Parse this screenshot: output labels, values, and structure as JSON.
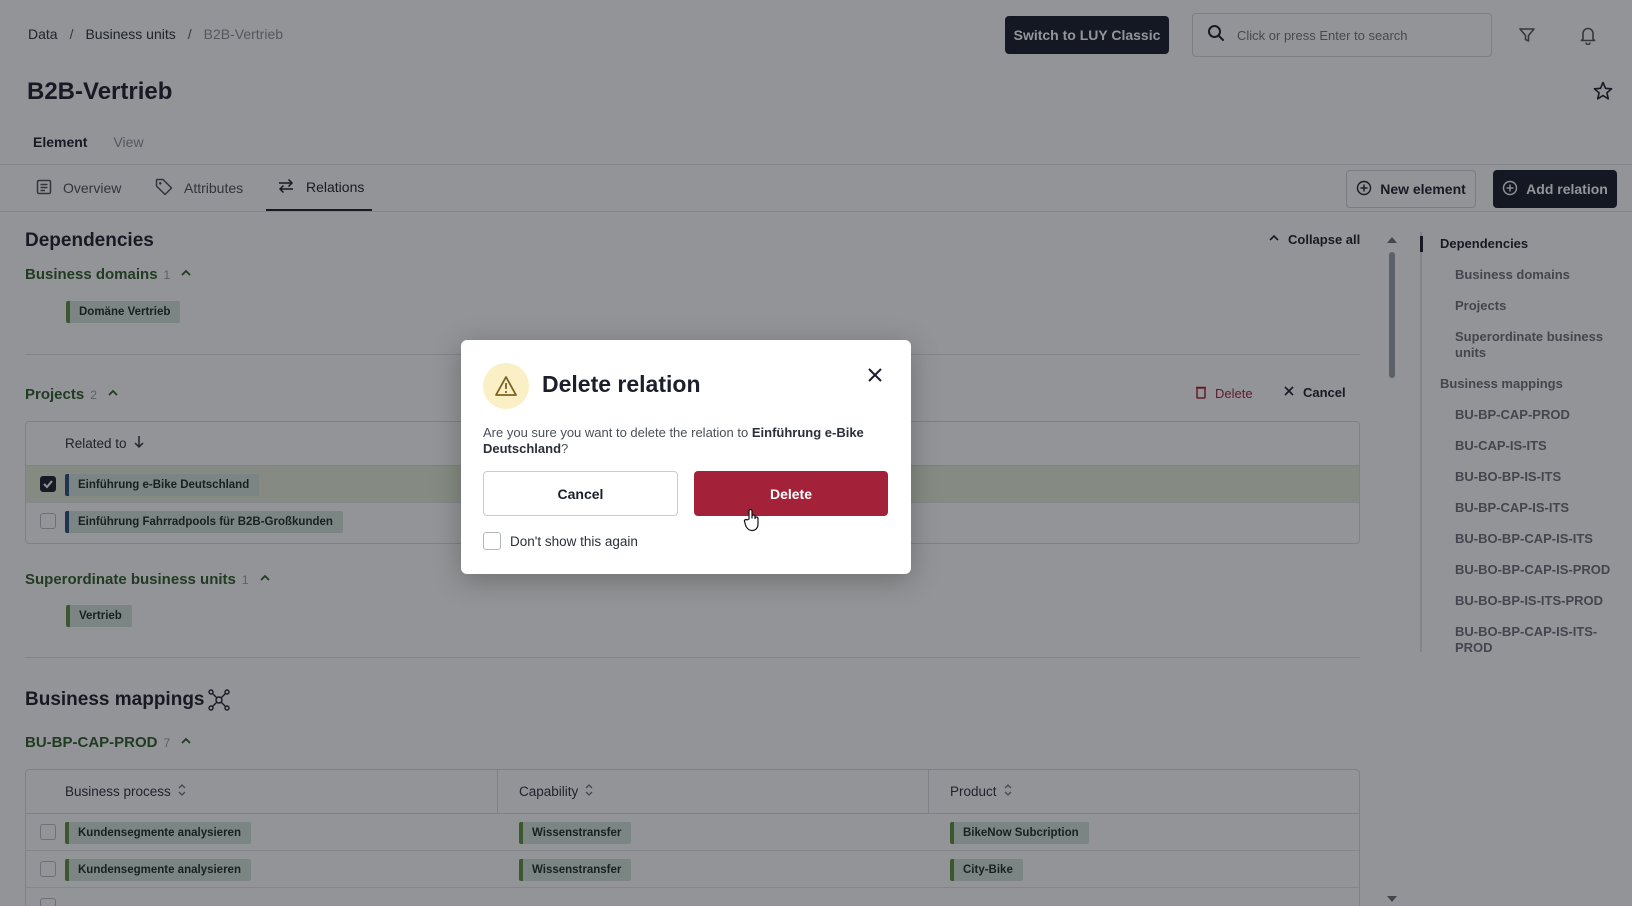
{
  "breadcrumb": {
    "root": "Data",
    "parent": "Business units",
    "current": "B2B-Vertrieb"
  },
  "header": {
    "switch_label": "Switch to LUY Classic",
    "search_placeholder": "Click or press Enter to search"
  },
  "page": {
    "title": "B2B-Vertrieb"
  },
  "subtabs": {
    "element": "Element",
    "view": "View"
  },
  "tabs": {
    "overview": "Overview",
    "attributes": "Attributes",
    "relations": "Relations"
  },
  "toolbar": {
    "new_element": "New element",
    "add_relation": "Add relation"
  },
  "dependencies": {
    "title": "Dependencies",
    "collapse_all": "Collapse all",
    "business_domains": {
      "label": "Business domains",
      "count": "1",
      "items": [
        "Domäne Vertrieb"
      ]
    },
    "projects": {
      "label": "Projects",
      "count": "2",
      "delete": "Delete",
      "cancel": "Cancel",
      "column": "Related to",
      "rows": [
        {
          "name": "Einführung e-Bike Deutschland",
          "checked": true
        },
        {
          "name": "Einführung Fahrradpools für B2B-Großkunden",
          "checked": false
        }
      ]
    },
    "superordinate": {
      "label": "Superordinate business units",
      "count": "1",
      "items": [
        "Vertrieb"
      ]
    }
  },
  "business_mappings": {
    "title": "Business mappings",
    "group": {
      "label": "BU-BP-CAP-PROD",
      "count": "7"
    },
    "columns": [
      "Business process",
      "Capability",
      "Product"
    ],
    "rows": [
      [
        "Kundensegmente analysieren",
        "Wissenstransfer",
        "BikeNow Subcription"
      ],
      [
        "Kundensegmente analysieren",
        "Wissenstransfer",
        "City-Bike"
      ]
    ]
  },
  "right_nav": {
    "dependencies": "Dependencies",
    "dep_items": [
      "Business domains",
      "Projects",
      "Superordinate business units"
    ],
    "mappings": "Business mappings",
    "map_items": [
      "BU-BP-CAP-PROD",
      "BU-CAP-IS-ITS",
      "BU-BO-BP-IS-ITS",
      "BU-BP-CAP-IS-ITS",
      "BU-BO-BP-CAP-IS-ITS",
      "BU-BO-BP-CAP-IS-PROD",
      "BU-BO-BP-IS-ITS-PROD",
      "BU-BO-BP-CAP-IS-ITS-PROD"
    ]
  },
  "modal": {
    "title": "Delete relation",
    "text_prefix": "Are you sure you want to delete the relation to ",
    "target": "Einführung e-Bike Deutschland",
    "text_suffix": "?",
    "cancel": "Cancel",
    "delete": "Delete",
    "dont_show": "Don't show this again"
  },
  "colors": {
    "danger": "#a3223a",
    "primary": "#141a27",
    "chip_green": "#5f8f3e",
    "chip_blue": "#2b4f7e",
    "warn_bg": "#fbefc6"
  }
}
